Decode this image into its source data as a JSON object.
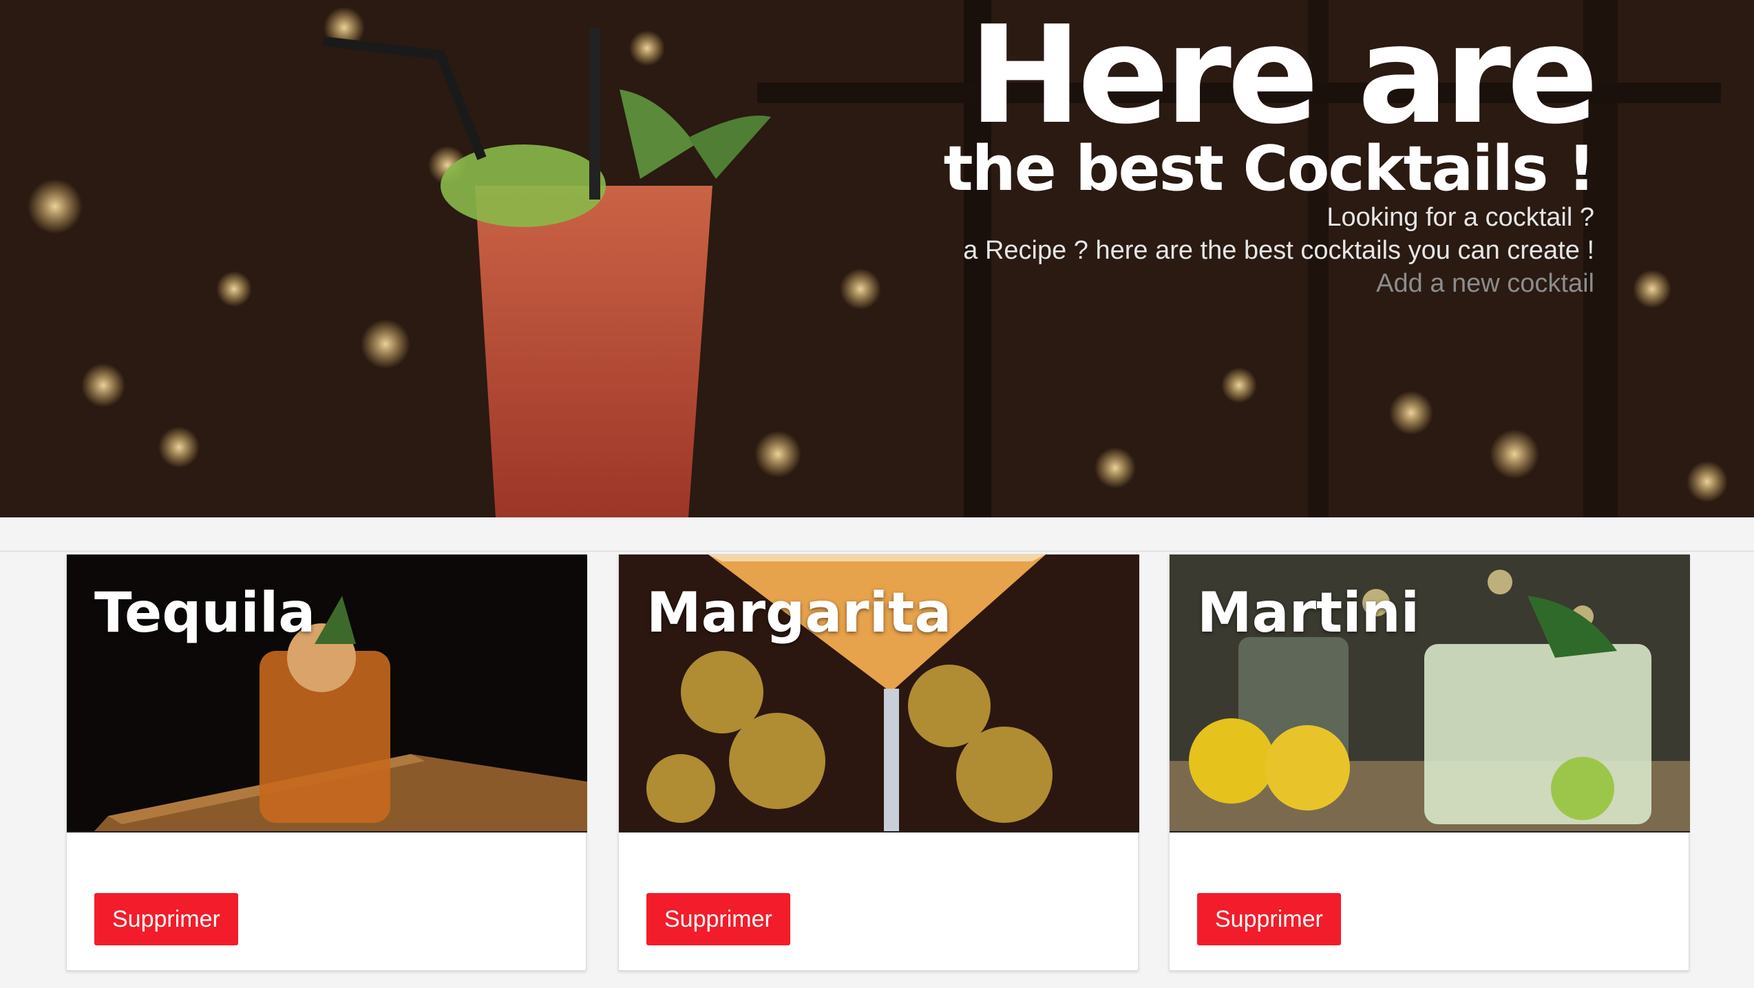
{
  "hero": {
    "title_big": "Here are",
    "title_small": "the best Cocktails !",
    "subtitle_line1": "Looking for a cocktail ?",
    "subtitle_line2": "a Recipe ? here are the best cocktails you can create !",
    "add_link": "Add a new cocktail"
  },
  "cards": [
    {
      "name": "Tequila",
      "delete_label": "Supprimer",
      "image": "tequila-cocktail-photo"
    },
    {
      "name": "Margarita",
      "delete_label": "Supprimer",
      "image": "margarita-cocktail-photo"
    },
    {
      "name": "Martini",
      "delete_label": "Supprimer",
      "image": "martini-cocktail-photo"
    }
  ],
  "colors": {
    "delete_button": "#f31c2a",
    "page_background": "#f4f4f4",
    "link_muted": "#8c8c8c"
  }
}
